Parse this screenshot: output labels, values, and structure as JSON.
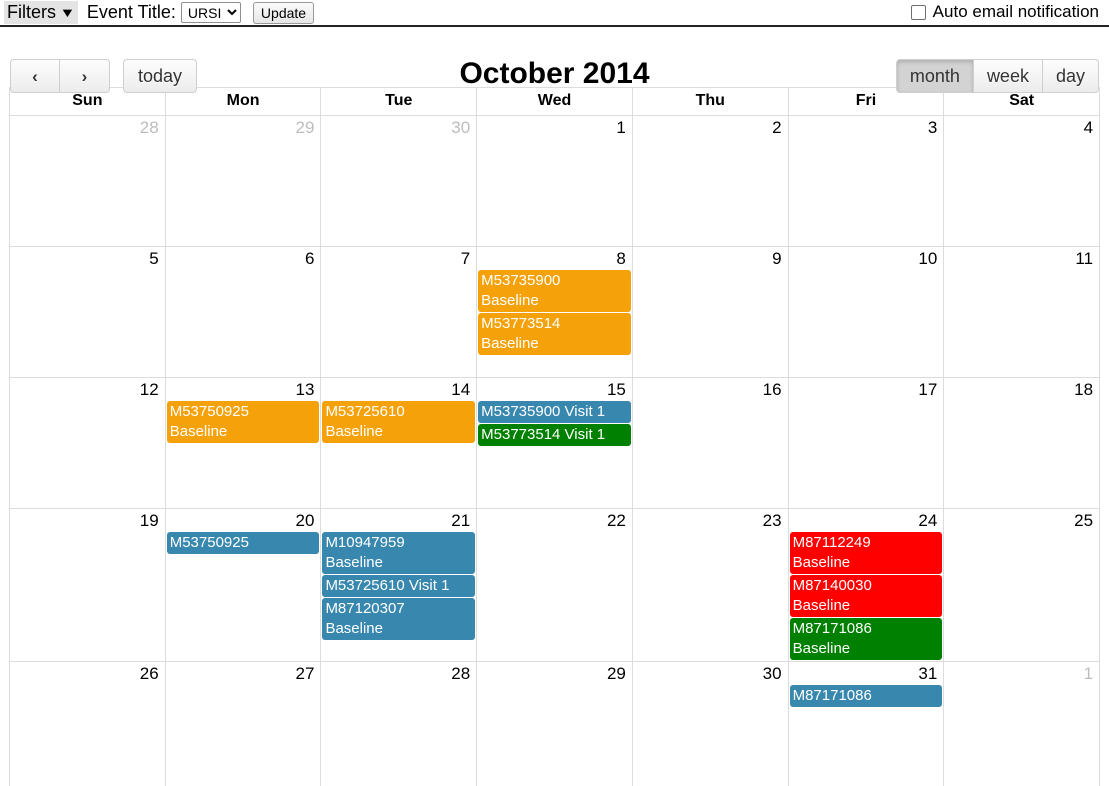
{
  "filterbar": {
    "filters_label": "Filters",
    "filters_caret": "▼",
    "event_title_label": "Event Title:",
    "event_title_value": "URSI",
    "event_title_options": [
      "URSI"
    ],
    "update_label": "Update",
    "auto_email_label": "Auto email notification",
    "auto_email_checked": false
  },
  "toolbar": {
    "prev_label": "‹",
    "next_label": "›",
    "today_label": "today",
    "title": "October 2014",
    "views": [
      {
        "label": "month",
        "active": true
      },
      {
        "label": "week",
        "active": false
      },
      {
        "label": "day",
        "active": false
      }
    ]
  },
  "colors": {
    "orange": "#f5a10a",
    "blue": "#3887ae",
    "green": "#008000",
    "red": "#ff0000",
    "grid_line": "#dcdcdc",
    "other_month_text": "#bdbdbd"
  },
  "calendar": {
    "day_headers": [
      "Sun",
      "Mon",
      "Tue",
      "Wed",
      "Thu",
      "Fri",
      "Sat"
    ],
    "weeks": [
      [
        {
          "daynum": "28",
          "other_month": true,
          "events": []
        },
        {
          "daynum": "29",
          "other_month": true,
          "events": []
        },
        {
          "daynum": "30",
          "other_month": true,
          "events": []
        },
        {
          "daynum": "1",
          "other_month": false,
          "events": []
        },
        {
          "daynum": "2",
          "other_month": false,
          "events": []
        },
        {
          "daynum": "3",
          "other_month": false,
          "events": []
        },
        {
          "daynum": "4",
          "other_month": false,
          "events": []
        }
      ],
      [
        {
          "daynum": "5",
          "other_month": false,
          "events": []
        },
        {
          "daynum": "6",
          "other_month": false,
          "events": []
        },
        {
          "daynum": "7",
          "other_month": false,
          "events": []
        },
        {
          "daynum": "8",
          "other_month": false,
          "events": [
            {
              "lines": [
                "M53735900",
                "Baseline"
              ],
              "color": "#f5a10a"
            },
            {
              "lines": [
                "M53773514",
                "Baseline"
              ],
              "color": "#f5a10a"
            }
          ]
        },
        {
          "daynum": "9",
          "other_month": false,
          "events": []
        },
        {
          "daynum": "10",
          "other_month": false,
          "events": []
        },
        {
          "daynum": "11",
          "other_month": false,
          "events": []
        }
      ],
      [
        {
          "daynum": "12",
          "other_month": false,
          "events": []
        },
        {
          "daynum": "13",
          "other_month": false,
          "events": [
            {
              "lines": [
                "M53750925",
                "Baseline"
              ],
              "color": "#f5a10a"
            }
          ]
        },
        {
          "daynum": "14",
          "other_month": false,
          "events": [
            {
              "lines": [
                "M53725610",
                "Baseline"
              ],
              "color": "#f5a10a"
            }
          ]
        },
        {
          "daynum": "15",
          "other_month": false,
          "events": [
            {
              "lines": [
                "M53735900 Visit 1"
              ],
              "color": "#3887ae"
            },
            {
              "lines": [
                "M53773514 Visit 1"
              ],
              "color": "#008000"
            }
          ]
        },
        {
          "daynum": "16",
          "other_month": false,
          "events": []
        },
        {
          "daynum": "17",
          "other_month": false,
          "events": []
        },
        {
          "daynum": "18",
          "other_month": false,
          "events": []
        }
      ],
      [
        {
          "daynum": "19",
          "other_month": false,
          "events": []
        },
        {
          "daynum": "20",
          "other_month": false,
          "events": [
            {
              "lines": [
                "M53750925"
              ],
              "color": "#3887ae"
            }
          ]
        },
        {
          "daynum": "21",
          "other_month": false,
          "events": [
            {
              "lines": [
                "M10947959",
                "Baseline"
              ],
              "color": "#3887ae"
            },
            {
              "lines": [
                "M53725610 Visit 1"
              ],
              "color": "#3887ae"
            },
            {
              "lines": [
                "M87120307",
                "Baseline"
              ],
              "color": "#3887ae"
            }
          ]
        },
        {
          "daynum": "22",
          "other_month": false,
          "events": []
        },
        {
          "daynum": "23",
          "other_month": false,
          "events": []
        },
        {
          "daynum": "24",
          "other_month": false,
          "events": [
            {
              "lines": [
                "M87112249",
                "Baseline"
              ],
              "color": "#ff0000"
            },
            {
              "lines": [
                "M87140030",
                "Baseline"
              ],
              "color": "#ff0000"
            },
            {
              "lines": [
                "M87171086",
                "Baseline"
              ],
              "color": "#008000"
            }
          ]
        },
        {
          "daynum": "25",
          "other_month": false,
          "events": []
        }
      ],
      [
        {
          "daynum": "26",
          "other_month": false,
          "events": []
        },
        {
          "daynum": "27",
          "other_month": false,
          "events": []
        },
        {
          "daynum": "28",
          "other_month": false,
          "events": []
        },
        {
          "daynum": "29",
          "other_month": false,
          "events": []
        },
        {
          "daynum": "30",
          "other_month": false,
          "events": []
        },
        {
          "daynum": "31",
          "other_month": false,
          "events": [
            {
              "lines": [
                "M87171086"
              ],
              "color": "#3887ae"
            }
          ]
        },
        {
          "daynum": "1",
          "other_month": true,
          "events": []
        }
      ]
    ]
  }
}
